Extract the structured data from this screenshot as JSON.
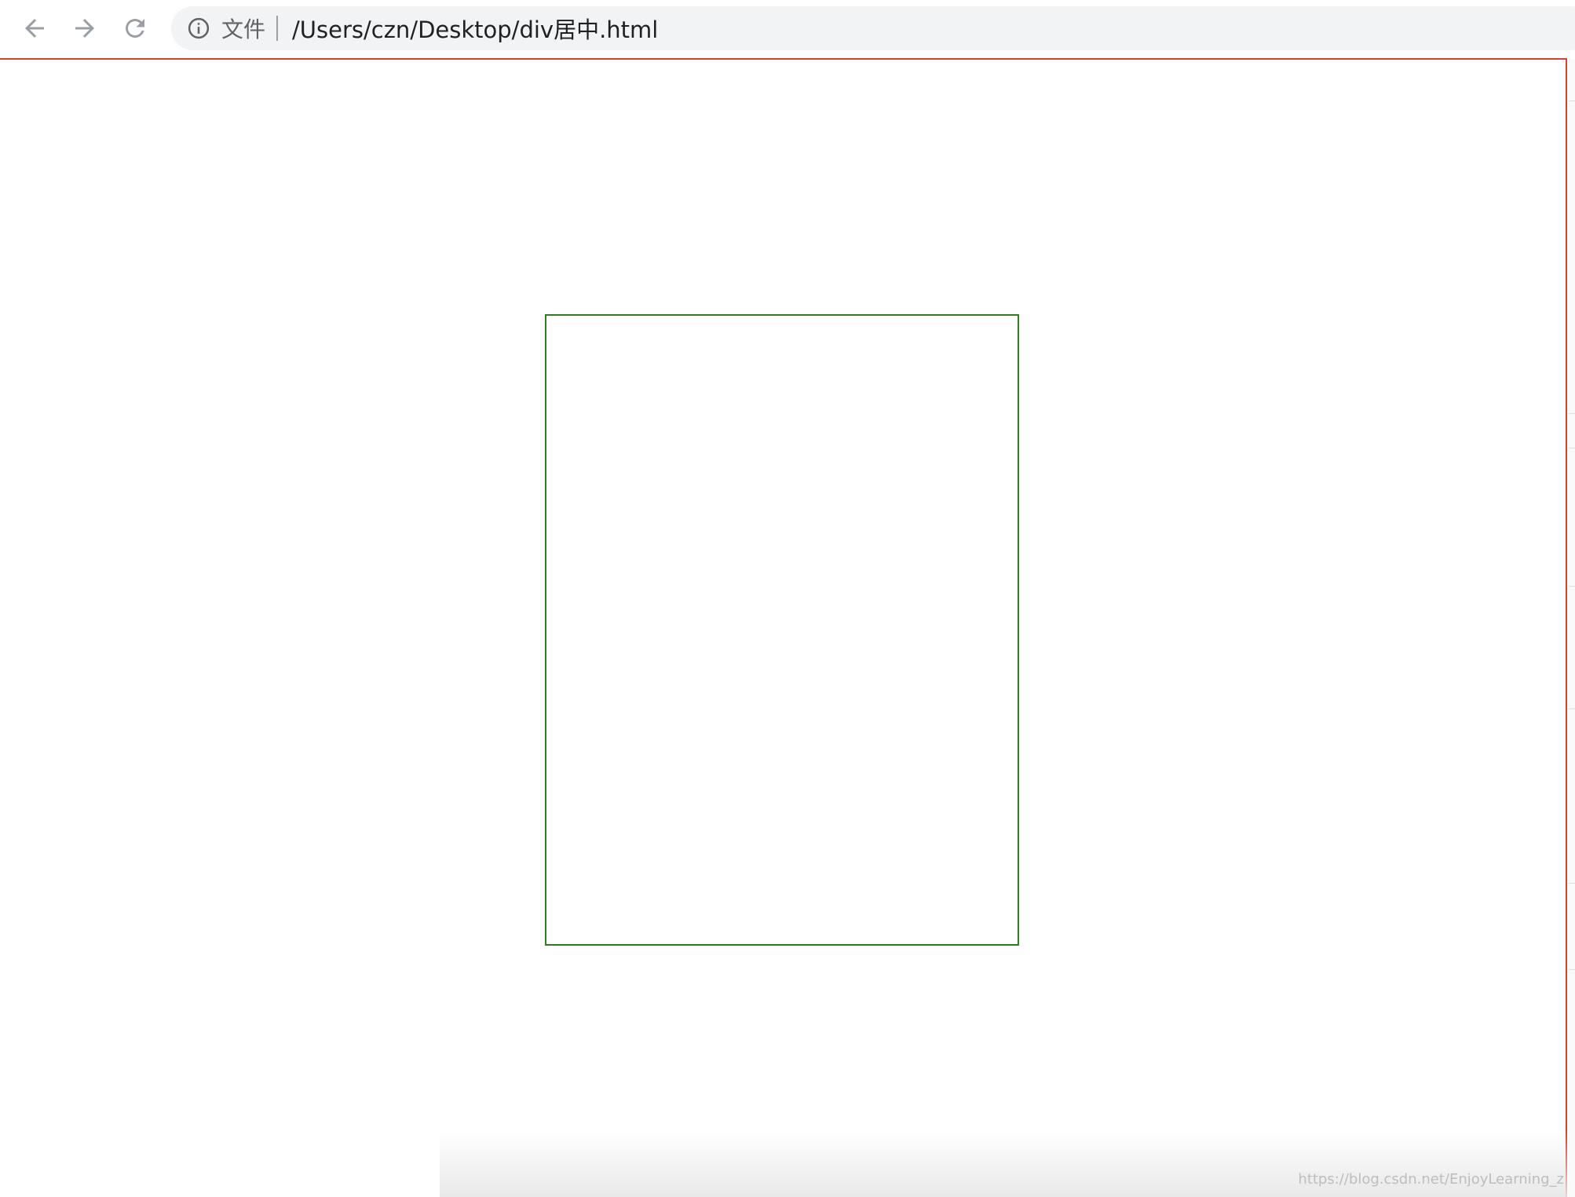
{
  "address_bar": {
    "scheme_label": "文件",
    "url": "/Users/czn/Desktop/div居中.html"
  },
  "icons": {
    "back": "arrow-left-icon",
    "forward": "arrow-right-icon",
    "reload": "reload-icon",
    "info": "info-icon"
  },
  "colors": {
    "outer_border": "#e03c31",
    "inner_box_border": "#2e7d1e"
  },
  "watermark": {
    "text": "https://blog.csdn.net/EnjoyLearning_z"
  }
}
